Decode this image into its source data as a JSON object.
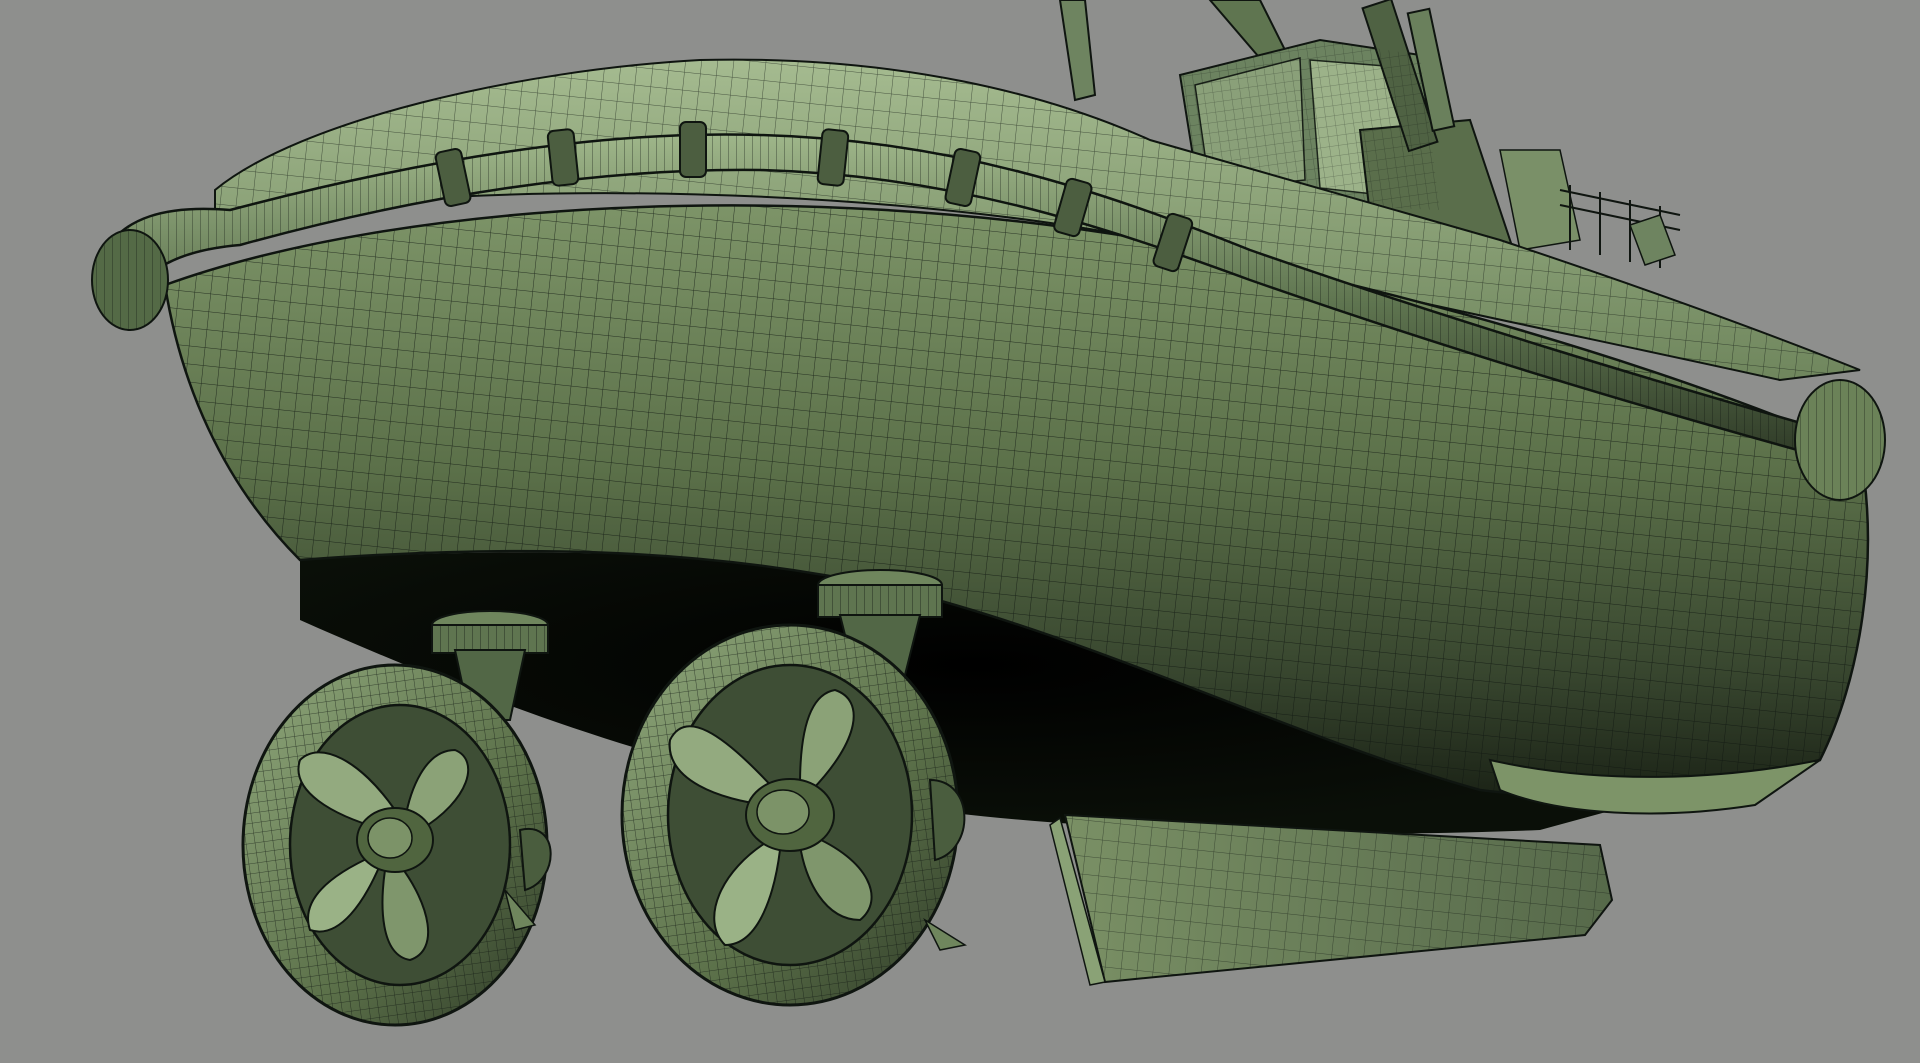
{
  "viewport": {
    "background_color": "#8e8f8d",
    "shading": "wireframe-on-shaded",
    "subject": "tugboat-hull-3d-model"
  },
  "model": {
    "hull_color": "#5f7550",
    "hull_highlight_color": "#9fb58c",
    "hull_shadow_color": "#1f2a1a",
    "wire_color": "#0f1510",
    "fender_color": "#6d8460",
    "thruster_count": 2,
    "propeller_blades_per_thruster": 4
  }
}
